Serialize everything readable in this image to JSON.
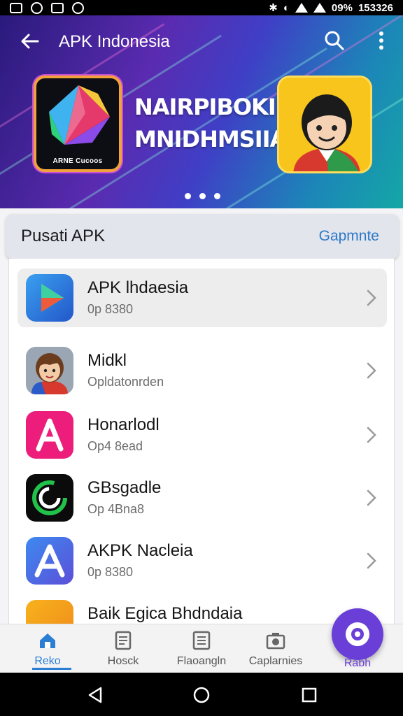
{
  "status_bar": {
    "battery": "09%",
    "time": "153326"
  },
  "header": {
    "title": "APK Indonesia"
  },
  "banner": {
    "left_app_caption": "ARNE Cucoos",
    "headline_lines": [
      "NAIRPIBOKIIN",
      "MNIDHMSIIAT"
    ],
    "page_count": 3
  },
  "section": {
    "title": "Pusati APK",
    "link": "Gapmnte"
  },
  "apps": [
    {
      "title": "APK lhdaesia",
      "subtitle": "0p 8380",
      "icon": "play-triangle-icon",
      "selected": true
    },
    {
      "title": "Midkl",
      "subtitle": "Opldatonrden",
      "icon": "boy-avatar-icon",
      "selected": false
    },
    {
      "title": "Honarlodl",
      "subtitle": "Op4 8ead",
      "icon": "letter-a-pink-icon",
      "selected": false
    },
    {
      "title": "GBsgadle",
      "subtitle": "Op 4Bna8",
      "icon": "green-ring-icon",
      "selected": false
    },
    {
      "title": "AKPK Nacleia",
      "subtitle": "0p 8380",
      "icon": "letter-a-blue-icon",
      "selected": false
    },
    {
      "title": "Baik Egica Bhdndaia",
      "subtitle": "",
      "icon": "orange-app-icon",
      "selected": false
    }
  ],
  "bottom_nav": [
    {
      "label": "Reko",
      "icon": "home-icon",
      "active": true
    },
    {
      "label": "Hosck",
      "icon": "document-icon",
      "active": false
    },
    {
      "label": "Flaoangln",
      "icon": "list-icon",
      "active": false
    },
    {
      "label": "Caplarnies",
      "icon": "camera-icon",
      "active": false
    }
  ],
  "fab": {
    "label": "Rabh",
    "icon": "gear-icon"
  },
  "colors": {
    "accent": "#2b7ed3",
    "fab": "#6a3fd8",
    "banner_start": "#2a1a7c",
    "banner_end": "#14a7a6"
  }
}
